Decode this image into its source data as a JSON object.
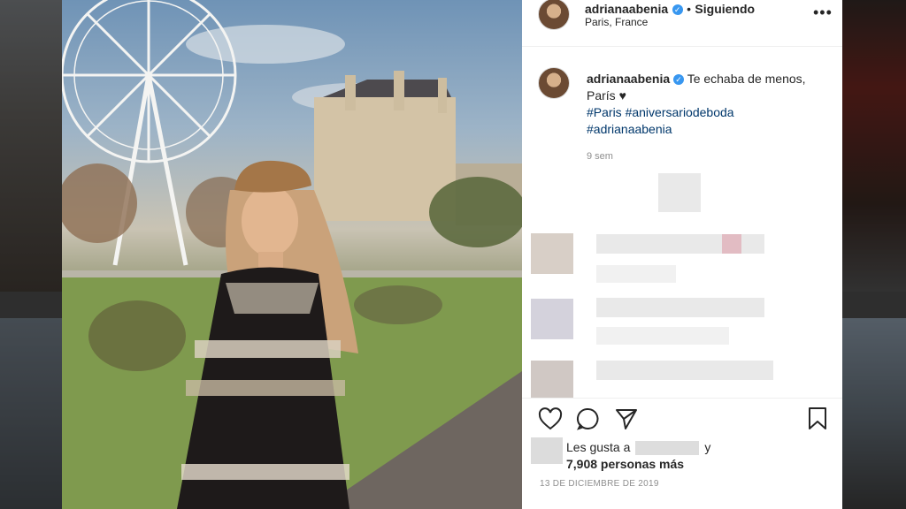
{
  "post": {
    "username": "adrianaabenia",
    "separator": "•",
    "follow_status": "Siguiendo",
    "location": "Paris, France",
    "more": "•••"
  },
  "caption": {
    "username": "adrianaabenia",
    "text": "Te echaba de menos, París ♥",
    "hashtags": [
      "#Paris",
      "#aniversariodeboda",
      "#adrianaabenia"
    ],
    "time": "9 sem"
  },
  "likes": {
    "prefix": "Les gusta a",
    "and": "y",
    "count_text": "7,908 personas más"
  },
  "date": "13 DE DICIEMBRE DE 2019",
  "icons": [
    "heart-icon",
    "comment-icon",
    "share-icon",
    "bookmark-icon",
    "verified-badge-icon",
    "more-options-icon"
  ],
  "colors": {
    "hashtag": "#00376b",
    "verified": "#3897f0",
    "muted": "#8e8e8e"
  }
}
